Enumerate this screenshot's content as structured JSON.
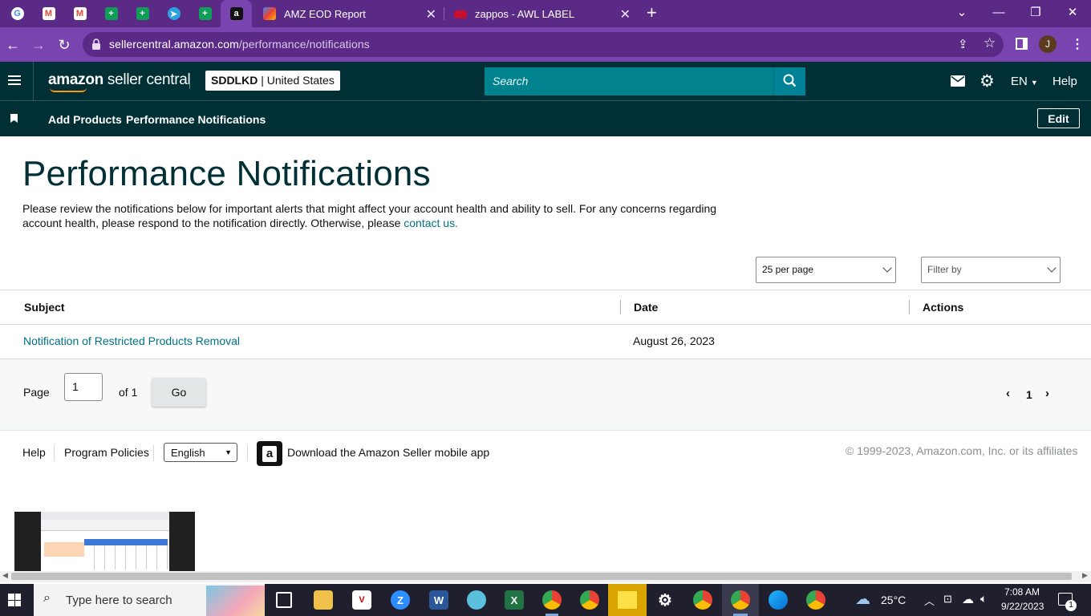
{
  "browser": {
    "tabs": [
      {
        "title": "AMZ EOD Report",
        "close": "✕"
      },
      {
        "title": "zappos - AWL LABEL",
        "close": "✕"
      }
    ],
    "new_tab": "+",
    "url_host": "sellercentral.amazon.com",
    "url_path": "/performance/notifications",
    "profile_initial": "J"
  },
  "header": {
    "logo_amazon": "amazon",
    "logo_rest": " seller central",
    "store_name": "SDDLKD",
    "store_sep": " | ",
    "store_region": "United States",
    "search_placeholder": "Search",
    "language": "EN",
    "help": "Help"
  },
  "nav": {
    "items": [
      "Add Products",
      "Performance Notifications"
    ],
    "edit": "Edit"
  },
  "page": {
    "title": "Performance Notifications",
    "description": "Please review the notifications below for important alerts that might affect your account health and ability to sell. For any concerns regarding account health, please respond to the notification directly. Otherwise, please ",
    "contact_link": "contact us.",
    "per_page": "25 per page",
    "filter": "Filter by"
  },
  "table": {
    "columns": [
      "Subject",
      "Date",
      "Actions"
    ],
    "rows": [
      {
        "subject": "Notification of Restricted Products Removal",
        "date": "August 26, 2023",
        "actions": ""
      }
    ]
  },
  "pagination": {
    "page_label": "Page",
    "page_value": "1",
    "of_label": "of 1",
    "go": "Go",
    "current": "1"
  },
  "footer": {
    "help": "Help",
    "program_policies": "Program Policies",
    "language": "English",
    "app_text": "Download the Amazon Seller mobile app",
    "copyright": "© 1999-2023, Amazon.com, Inc. or its affiliates"
  },
  "taskbar": {
    "search_placeholder": "Type here to search",
    "temperature": "25°C",
    "time": "7:08 AM",
    "date": "9/22/2023",
    "notifications": "1"
  },
  "colors": {
    "chrome_tabstrip": "#5b2a86",
    "chrome_toolbar": "#7a44b0",
    "seller_header": "#002f36",
    "search_button": "#00838f",
    "link": "#007185",
    "taskbar": "#1f1f2e"
  }
}
